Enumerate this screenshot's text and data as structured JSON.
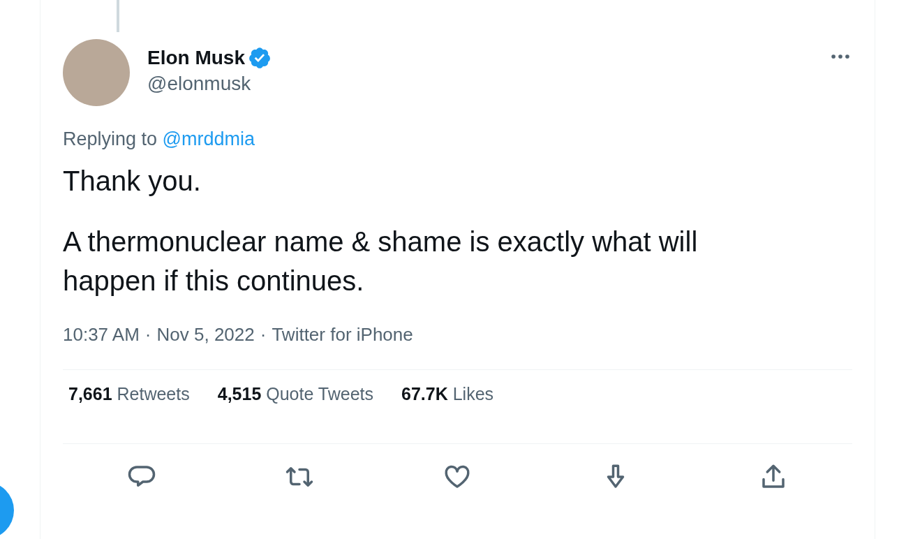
{
  "tweet": {
    "author": {
      "name": "Elon Musk",
      "verified": true,
      "handle": "@elonmusk"
    },
    "replying_to": {
      "label": "Replying to",
      "handle": "@mrddmia"
    },
    "paragraphs": [
      "Thank you.",
      "A thermonuclear name & shame is exactly what will happen if this continues."
    ],
    "meta": [
      "10:37 AM",
      "Nov 5, 2022",
      "Twitter for iPhone"
    ],
    "meta_separator": "·",
    "stats": [
      {
        "count": "7,661",
        "label": "Retweets"
      },
      {
        "count": "4,515",
        "label": "Quote Tweets"
      },
      {
        "count": "67.7K",
        "label": "Likes"
      }
    ],
    "actions": [
      {
        "kind": "reply"
      },
      {
        "kind": "retweet"
      },
      {
        "kind": "like"
      },
      {
        "kind": "bookmark"
      },
      {
        "kind": "share"
      }
    ]
  }
}
